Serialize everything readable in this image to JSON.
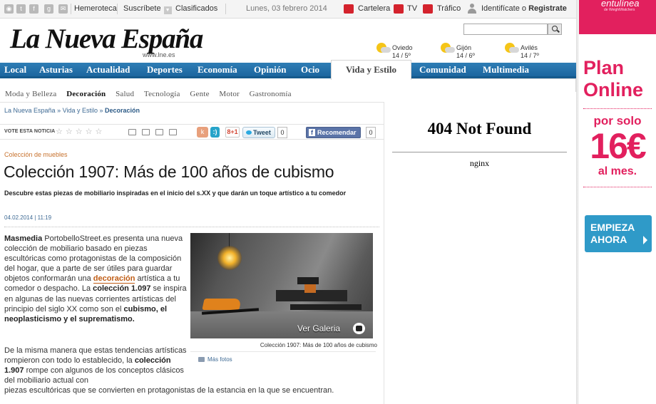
{
  "topbar": {
    "social_icons": [
      "rss-icon",
      "twitter-icon",
      "facebook-icon",
      "googleplus-icon",
      "mail-icon"
    ],
    "hemeroteca": "Hemeroteca",
    "suscribete": "Suscríbete",
    "clasificados": "Clasificados",
    "date": "Lunes, 03 febrero 2014",
    "cartelera": "Cartelera",
    "tv": "TV",
    "trafico": "Tráfico",
    "login_text": "Identifícate o",
    "register": "Registrate"
  },
  "header": {
    "logo": "La Nueva España",
    "url": "www.lne.es",
    "weather": [
      {
        "city": "Oviedo",
        "temp": "14 / 5º"
      },
      {
        "city": "Gijón",
        "temp": "14 / 6º"
      },
      {
        "city": "Avilés",
        "temp": "14 / 7º"
      }
    ]
  },
  "nav": {
    "items": [
      "Local",
      "Asturias",
      "Actualidad",
      "Deportes",
      "Economía",
      "Opinión",
      "Ocio"
    ],
    "active": "Vida y Estilo",
    "items_right": [
      "Comunidad",
      "Multimedia"
    ]
  },
  "subnav": {
    "items": [
      "Moda y Belleza",
      "Decoración",
      "Salud",
      "Tecnología",
      "Gente",
      "Motor",
      "Gastronomía"
    ],
    "selected": "Decoración"
  },
  "breadcrumb": {
    "home": "La Nueva España",
    "section": "Vida y Estilo",
    "current": "Decoración",
    "sep": "»"
  },
  "share": {
    "vote_label": "VOTE ESTA NOTICIA",
    "stars": "☆☆☆☆☆",
    "k_label": "k",
    "blue_label": ":)",
    "gplus": "8+1",
    "tweet": "Tweet",
    "tweet_count": "0",
    "recommend": "Recomendar",
    "recommend_count": "0"
  },
  "article": {
    "kicker": "Colección de muebles",
    "title": "Colección 1907: Más de 100 años de cubismo",
    "subtitle": "Descubre estas piezas de mobiliario inspiradas en el inicio del s.XX y que darán un toque artístico a tu comedor",
    "date": "04.02.2014",
    "time": "11:19",
    "date_sep": "|",
    "p1_bold": "Masmedia",
    "p1_a": " PortobelloStreet.es presenta una nueva colección de mobiliario basado en piezas escultóricas como protagonistas de la composición del hogar, que a parte de ser útiles para guardar objetos conformarán una ",
    "p1_link": "decoración",
    "p1_b": " artística a tu comedor o despacho. La ",
    "p1_bold2": "colección 1.097",
    "p1_c": " se inspira en algunas de las nuevas corrientes artísticas del principio del siglo XX como son el ",
    "p1_bold3": "cubismo, el neoplasticismo y el suprematismo.",
    "p2_a": "De la misma manera que estas tendencias artísticas rompieron con todo lo establecido, la ",
    "p2_bold": "colección 1.907",
    "p2_b": " rompe con algunos de los conceptos clásicos del mobiliario actual con",
    "p2_last": "piezas escultóricas que se convierten en protagonistas de la estancia en la que se encuentran.",
    "gallery_label": "Ver Galeria",
    "caption": "Colección 1907: Más de 100 años de cubismo",
    "more_photos": "Más fotos"
  },
  "error_panel": {
    "title": "404 Not Found",
    "server": "nginx"
  },
  "ad": {
    "brand": "entulínea",
    "brand_sub": "de WeightWatchers",
    "plan": "Plan Online",
    "por_solo": "por solo",
    "price": "16€",
    "al_mes": "al mes.",
    "cta": "EMPIEZA AHORA",
    "color_accent": "#e2205e",
    "color_cta": "#2f9ac8"
  },
  "colors": {
    "nav_blue": "#1c669f",
    "link_blue": "#3e6a94",
    "kicker_orange": "#c7712c"
  }
}
